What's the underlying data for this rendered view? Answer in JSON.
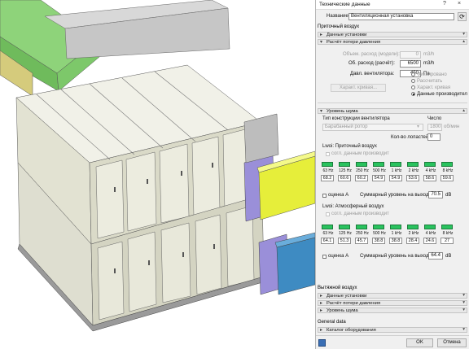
{
  "window": {
    "title": "Технические данные",
    "help_icon": "?",
    "close_icon": "×"
  },
  "name_label": "Название:",
  "name_value": "Вентиляционная установка",
  "supply": {
    "header": "Приточный воздух",
    "unit_data": "Данные установки",
    "pressure_calc": "Расчёт потери давления",
    "volume_flow_model": {
      "label": "Объем. расход (модели):",
      "value": "0",
      "unit": "m3/h"
    },
    "volume_flow_calc": {
      "label": "Об. расход (расчёт):",
      "value": "6500",
      "unit": "m3/h"
    },
    "fan_pressure": {
      "label": "Давл. вентилятора:",
      "value": "450",
      "unit": "Па"
    },
    "curve_button": "Характ. кривая...",
    "radios": [
      "Фиксировано",
      "Рассчитать",
      "Характ. кривая",
      "Данные производител"
    ],
    "selected_radio": 3,
    "noise_level": "Уровень шума",
    "fan_type_label": "Тип конструкции вентилятора",
    "fan_type_value": "Барабанный ротор",
    "rpm_label": "Число",
    "rpm_value": "1800",
    "rpm_unit": "об/мин",
    "blades_label": "Кол-во лопастей:",
    "blades_value": "0",
    "lwa_supply": {
      "title": "Lwoi: Приточный воздух",
      "manufacturer_checkbox": "согл. данным производит",
      "freqs": [
        "63 Hz",
        "125 Hz",
        "250 Hz",
        "500 Hz",
        "1 kHz",
        "2 kHz",
        "4 kHz",
        "8 kHz"
      ],
      "values": [
        "68.2",
        "60.6",
        "60.2",
        "54.9",
        "54.9",
        "53.6",
        "58.6",
        "59.6"
      ],
      "a_weighting": "оценка A",
      "total_label": "Суммарный уровень на выходе",
      "total_value": "70.5",
      "total_unit": "dB"
    },
    "lwa_outdoor": {
      "title": "Lwoi: Атмосферный воздух",
      "manufacturer_checkbox": "согл. данным производит",
      "freqs": [
        "63 Hz",
        "125 Hz",
        "250 Hz",
        "500 Hz",
        "1 kHz",
        "2 kHz",
        "4 kHz",
        "8 kHz"
      ],
      "values": [
        "64.1",
        "51.3",
        "45.7",
        "38.8",
        "38.8",
        "28.4",
        "24.6",
        "27"
      ],
      "a_weighting": "оценка A",
      "total_label": "Суммарный уровень на выходе",
      "total_value": "64.4",
      "total_unit": "dB"
    }
  },
  "exhaust": {
    "header": "Вытяжной воздух",
    "unit_data": "Данные установки",
    "pressure_calc": "Расчёт потери давления",
    "noise_level": "Уровень шума"
  },
  "general": {
    "header": "General data",
    "catalog": "Каталог оборудования"
  },
  "buttons": {
    "ok": "OK",
    "cancel": "Отмена"
  },
  "colors": {
    "duct_green": "#8ed37a",
    "duct_yellow": "#e6ee3a",
    "duct_blue": "#3e8bc2",
    "duct_olive": "#d8cf82",
    "ahu_body": "#e6e6d8",
    "flange_purple": "#9a8fd9",
    "spectrum_bar": "#29c25e"
  }
}
